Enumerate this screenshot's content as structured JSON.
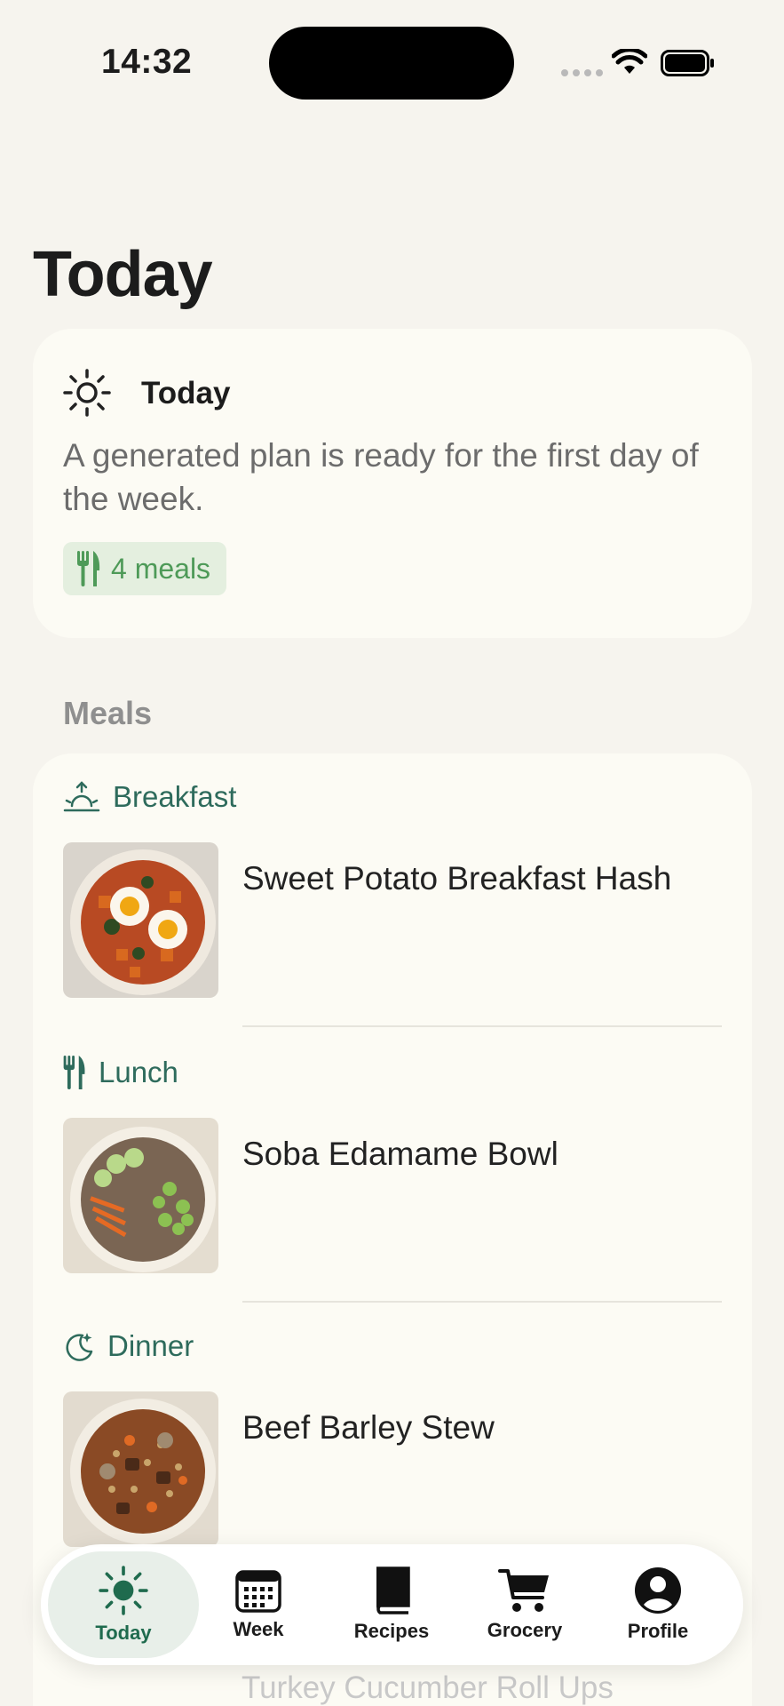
{
  "status_bar": {
    "time": "14:32"
  },
  "page": {
    "title": "Today"
  },
  "today_card": {
    "title": "Today",
    "description": "A generated plan is ready for the first day of the week.",
    "meals_badge": "4 meals",
    "icon": "sun-icon"
  },
  "meals_section": {
    "label": "Meals",
    "items": [
      {
        "type": "Breakfast",
        "icon": "sunrise-icon",
        "name": "Sweet Potato Breakfast Hash"
      },
      {
        "type": "Lunch",
        "icon": "fork-knife-icon",
        "name": "Soba Edamame Bowl"
      },
      {
        "type": "Dinner",
        "icon": "moon-icon",
        "name": "Beef Barley Stew"
      }
    ],
    "partially_visible_item": "Turkey Cucumber Roll Ups"
  },
  "tab_bar": {
    "tabs": [
      {
        "label": "Today",
        "icon": "sun-icon",
        "active": true
      },
      {
        "label": "Week",
        "icon": "calendar-icon",
        "active": false
      },
      {
        "label": "Recipes",
        "icon": "book-icon",
        "active": false
      },
      {
        "label": "Grocery",
        "icon": "cart-icon",
        "active": false
      },
      {
        "label": "Profile",
        "icon": "person-icon",
        "active": false
      }
    ]
  },
  "colors": {
    "background": "#f6f4ee",
    "card": "#fcfbf4",
    "accent_green": "#2e6b5c",
    "badge_bg": "#e4efdf",
    "badge_text": "#4e9a58"
  }
}
